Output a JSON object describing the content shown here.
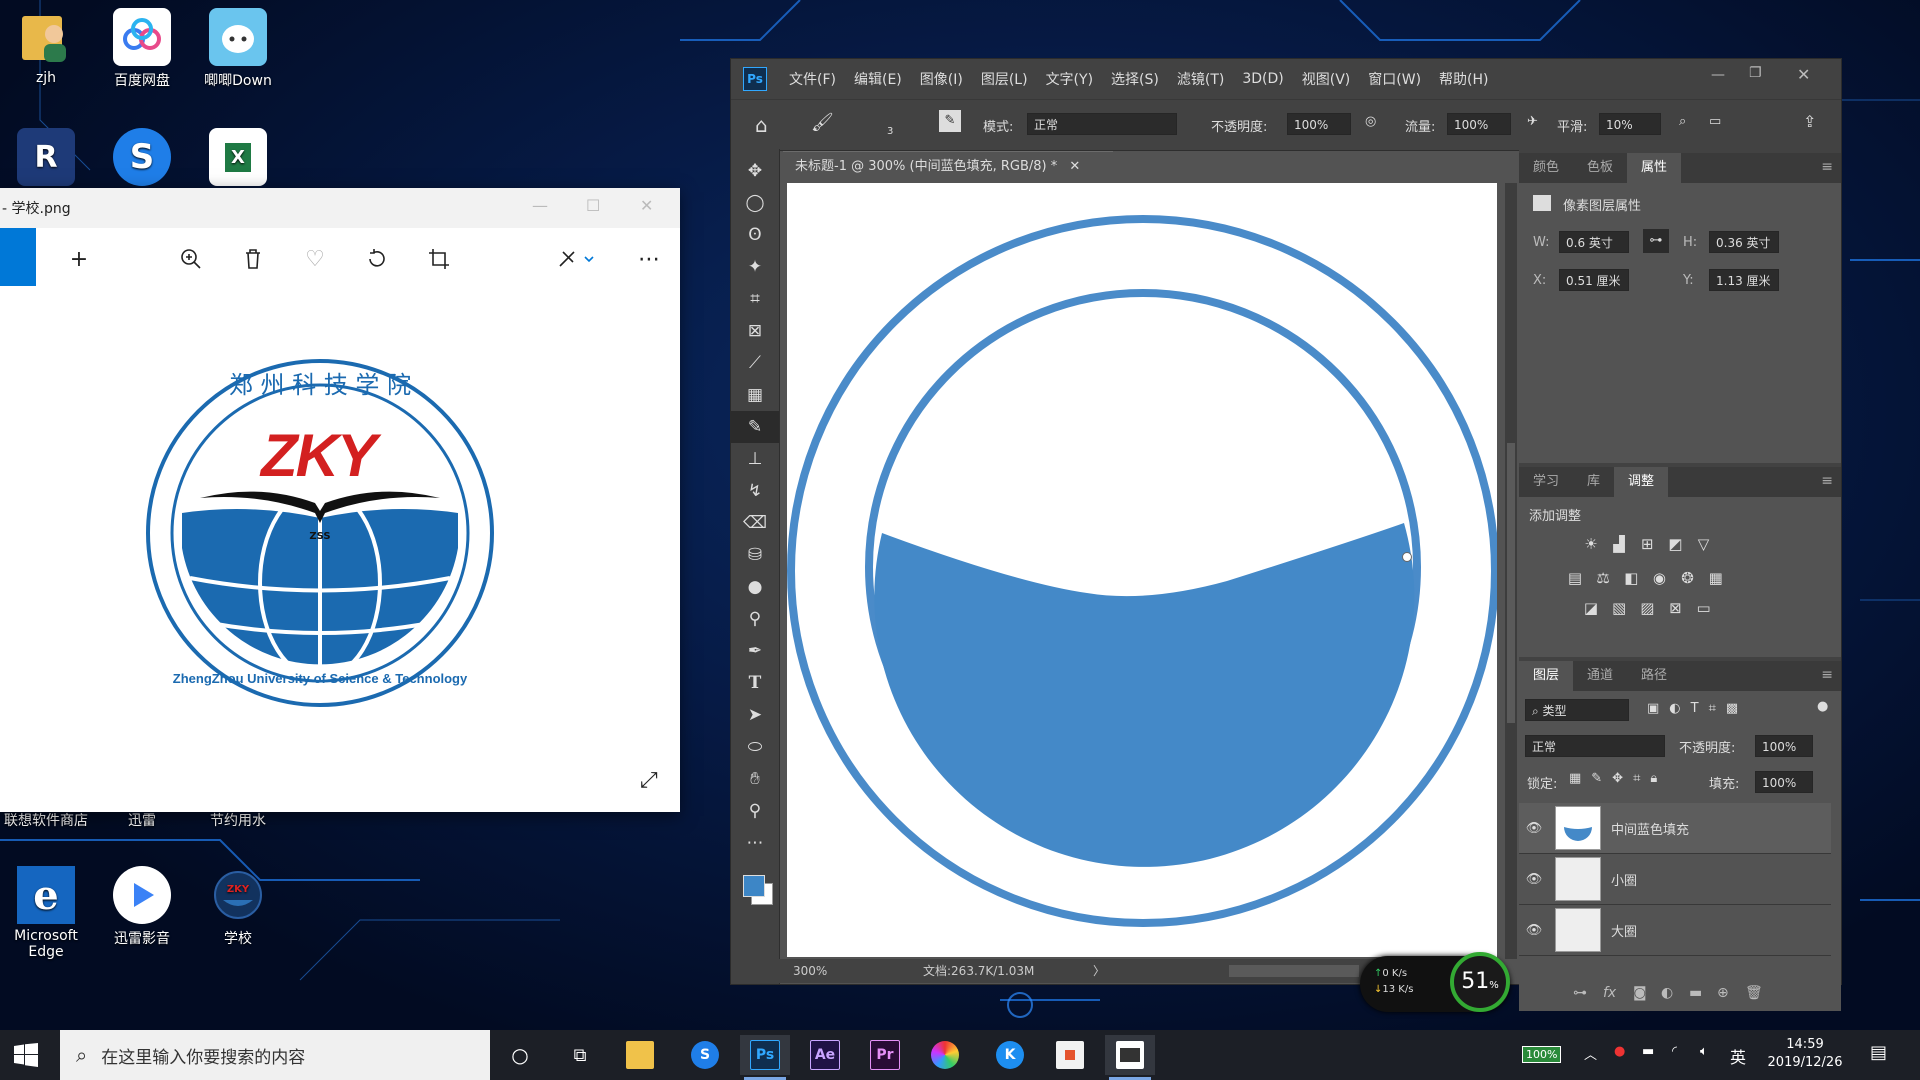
{
  "desktop": {
    "icons": [
      {
        "label": "zjh",
        "icon": "user-folder-icon"
      },
      {
        "label": "百度网盘",
        "icon": "baidu-netdisk-icon"
      },
      {
        "label": "唧唧Down",
        "icon": "jijidown-icon"
      },
      {
        "label": "联想软件商店",
        "icon": "lenovo-store-icon"
      },
      {
        "label": "迅雷",
        "icon": "thunder-icon"
      },
      {
        "label": "节约用水",
        "icon": "excel-file-icon"
      },
      {
        "label": "Microsoft Edge",
        "icon": "edge-icon"
      },
      {
        "label": "迅雷影音",
        "icon": "thunder-player-icon"
      },
      {
        "label": "学校",
        "icon": "school-logo-icon"
      }
    ]
  },
  "viewer": {
    "title": "- 学校.png",
    "logo": {
      "top_text": "郑 州 科 技 学 院",
      "letters": "ZKY",
      "bottom_text": "ZhengZhou University of Science & Technology",
      "small_text": "ZSS"
    }
  },
  "photoshop": {
    "logo": "Ps",
    "menu": [
      "文件(F)",
      "编辑(E)",
      "图像(I)",
      "图层(L)",
      "文字(Y)",
      "选择(S)",
      "滤镜(T)",
      "3D(D)",
      "视图(V)",
      "窗口(W)",
      "帮助(H)"
    ],
    "options": {
      "brush_size": "3",
      "mode_label": "模式:",
      "mode_value": "正常",
      "opacity_label": "不透明度:",
      "opacity_value": "100%",
      "flow_label": "流量:",
      "flow_value": "100%",
      "smooth_label": "平滑:",
      "smooth_value": "10%"
    },
    "doc_tab": "未标题-1 @ 300% (中间蓝色填充, RGB/8) *",
    "status": {
      "zoom": "300%",
      "doc": "文档:263.7K/1.03M"
    },
    "properties": {
      "tabs": [
        "颜色",
        "色板",
        "属性"
      ],
      "active_tab": "属性",
      "title": "像素图层属性",
      "w_label": "W:",
      "w": "0.6 英寸",
      "h_label": "H:",
      "h": "0.36 英寸",
      "x_label": "X:",
      "x": "0.51 厘米",
      "y_label": "Y:",
      "y": "1.13 厘米"
    },
    "adjust": {
      "tabs": [
        "学习",
        "库",
        "调整"
      ],
      "active_tab": "调整",
      "title": "添加调整"
    },
    "layers": {
      "tabs": [
        "图层",
        "通道",
        "路径"
      ],
      "active_tab": "图层",
      "filter_kind": "类型",
      "blend_mode": "正常",
      "opacity_label": "不透明度:",
      "opacity_value": "100%",
      "lock_label": "锁定:",
      "fill_label": "填充:",
      "fill_value": "100%",
      "items": [
        {
          "name": "中间蓝色填充",
          "selected": true
        },
        {
          "name": "小圈",
          "selected": false
        },
        {
          "name": "大圈",
          "selected": false
        }
      ]
    },
    "colors": {
      "foreground": "#3d86c6",
      "fill": "#4489c8",
      "ring": "#4a8bc9"
    }
  },
  "net_widget": {
    "up": "0  K/s",
    "down": "13  K/s",
    "percent": "51",
    "percent_unit": "%"
  },
  "taskbar": {
    "search_placeholder": "在这里输入你要搜索的内容",
    "battery": "100%",
    "ime": "英",
    "time": "14:59",
    "date": "2019/12/26"
  }
}
